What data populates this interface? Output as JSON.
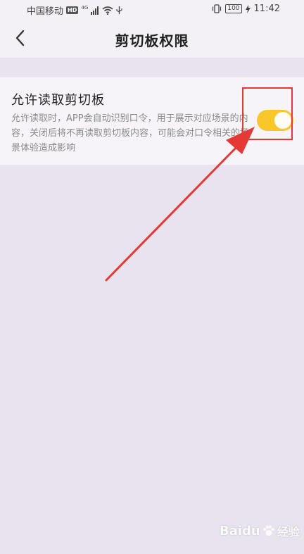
{
  "status_bar": {
    "carrier": "中国移动",
    "hd": "HD",
    "network": "4G",
    "battery": "100",
    "time": "11:42"
  },
  "header": {
    "title": "剪切板权限"
  },
  "setting": {
    "title": "允许读取剪切板",
    "description": "允许读取时，APP会自动识别口令，用于展示对应场景的内容，关闭后将不再读取剪切板内容，可能会对口令相关的场景体验造成影响",
    "toggle_on": true
  },
  "watermark": {
    "brand": "Baidu",
    "sub": "经验"
  },
  "colors": {
    "toggle_on": "#f8c72a",
    "annotation": "#e53935",
    "page_bg": "#e8e3ef"
  }
}
